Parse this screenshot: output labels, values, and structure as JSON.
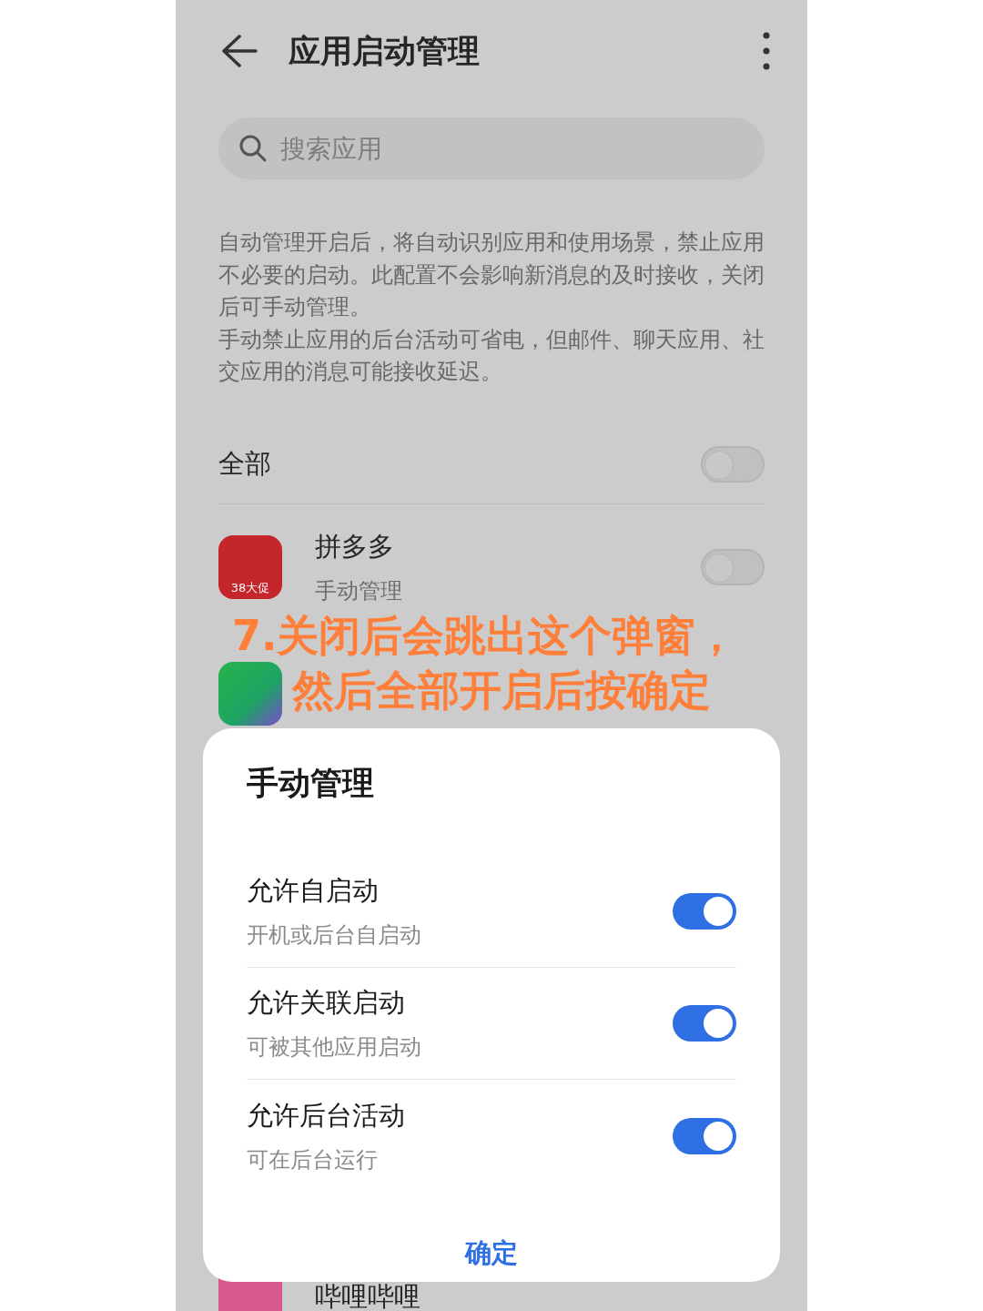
{
  "header": {
    "title": "应用启动管理"
  },
  "search": {
    "placeholder": "搜索应用"
  },
  "description": [
    "自动管理开启后，将自动识别应用和使用场景，禁止应用不必要的启动。此配置不会影响新消息的及时接收，关闭后可手动管理。",
    "手动禁止应用的后台活动可省电，但邮件、聊天应用、社交应用的消息可能接收延迟。"
  ],
  "all_row": {
    "label": "全部",
    "on": false
  },
  "apps": [
    {
      "kind": "pinduoduo",
      "name": "拼多多",
      "status": "手动管理",
      "icon_text": "38大促",
      "on": false
    },
    {
      "kind": "iqiyi"
    },
    {
      "kind": "bilibili",
      "name": "哔哩哔哩"
    }
  ],
  "annotation": [
    "7.关闭后会跳出这个弹窗，",
    "然后全部开启后按确定"
  ],
  "dialog": {
    "title": "手动管理",
    "options": [
      {
        "label": "允许自启动",
        "sub": "开机或后台自启动",
        "on": true
      },
      {
        "label": "允许关联启动",
        "sub": "可被其他应用启动",
        "on": true
      },
      {
        "label": "允许后台活动",
        "sub": "可在后台运行",
        "on": true
      }
    ],
    "button": "确定"
  }
}
